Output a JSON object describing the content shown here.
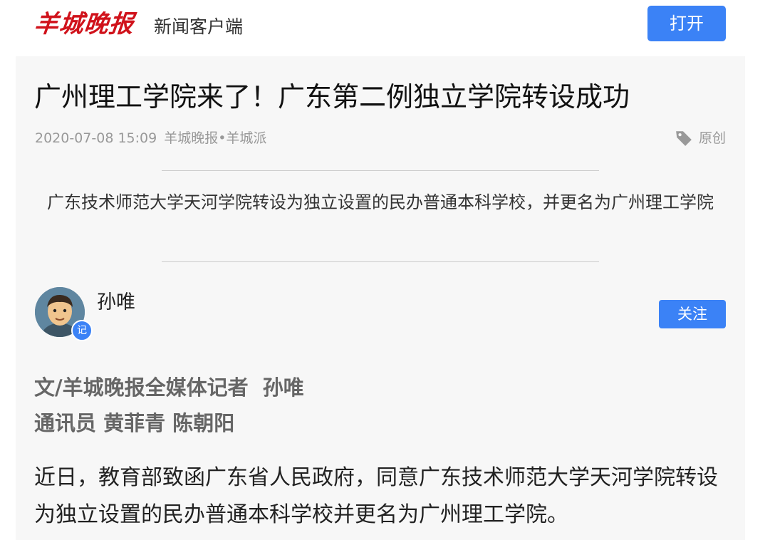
{
  "header": {
    "logo_text": "羊城晚报",
    "subtitle": "新闻客户端",
    "open_label": "打开"
  },
  "article": {
    "title": "广州理工学院来了！广东第二例独立学院转设成功",
    "datetime": "2020-07-08 15:09",
    "source": "羊城晚报•羊城派",
    "tag_label": "原创",
    "summary": "广东技术师范大学天河学院转设为独立设置的民办普通本科学校，并更名为广州理工学院",
    "author": {
      "name": "孙唯",
      "badge": "记",
      "follow_label": "关注"
    },
    "byline": {
      "line1": "文/羊城晚报全媒体记者  孙唯",
      "line2": "通讯员 黄菲青 陈朝阳"
    },
    "body": "近日，教育部致函广东省人民政府，同意广东技术师范大学天河学院转设为独立设置的民办普通本科学校并更名为广州理工学院。"
  },
  "colors": {
    "brand_red": "#d0121b",
    "accent_blue": "#3b82f6",
    "meta_gray": "#999999"
  },
  "icons": {
    "tag": "tag-icon"
  }
}
